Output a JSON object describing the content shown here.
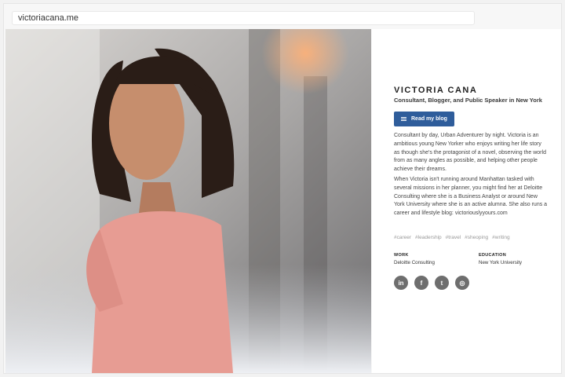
{
  "browser": {
    "url": "victoriacana.me"
  },
  "profile": {
    "name": "VICTORIA CANA",
    "tagline": "Consultant, Blogger, and Public Speaker in New York",
    "button_label": "Read my blog",
    "bio_paragraph_1": "Consultant by day, Urban Adventurer by night. Victoria is an ambitious young New Yorker who enjoys writing her life story as though she's the protagonist of a novel, observing the world from as many angles as possible, and helping other people achieve their dreams.",
    "bio_paragraph_2": "When Victoria isn't running around Manhattan tasked with several missions in her planner, you might find her at Deloitte Consulting where she is a Business Analyst or around New York University where she is an active alumna. She also runs a career and lifestyle blog: victoriouslyyours.com",
    "tags": [
      "#career",
      "#leadership",
      "#travel",
      "#sheoping",
      "#writing"
    ],
    "work_label": "WORK",
    "work_value": "Deloitte Consulting",
    "education_label": "EDUCATION",
    "education_value": "New York University",
    "socials": [
      {
        "icon": "linkedin-icon",
        "glyph": "in"
      },
      {
        "icon": "facebook-icon",
        "glyph": "f"
      },
      {
        "icon": "twitter-icon",
        "glyph": "t"
      },
      {
        "icon": "instagram-icon",
        "glyph": "◎"
      }
    ]
  },
  "colors": {
    "accent": "#2f5d9b",
    "social": "#6e6e6e"
  }
}
